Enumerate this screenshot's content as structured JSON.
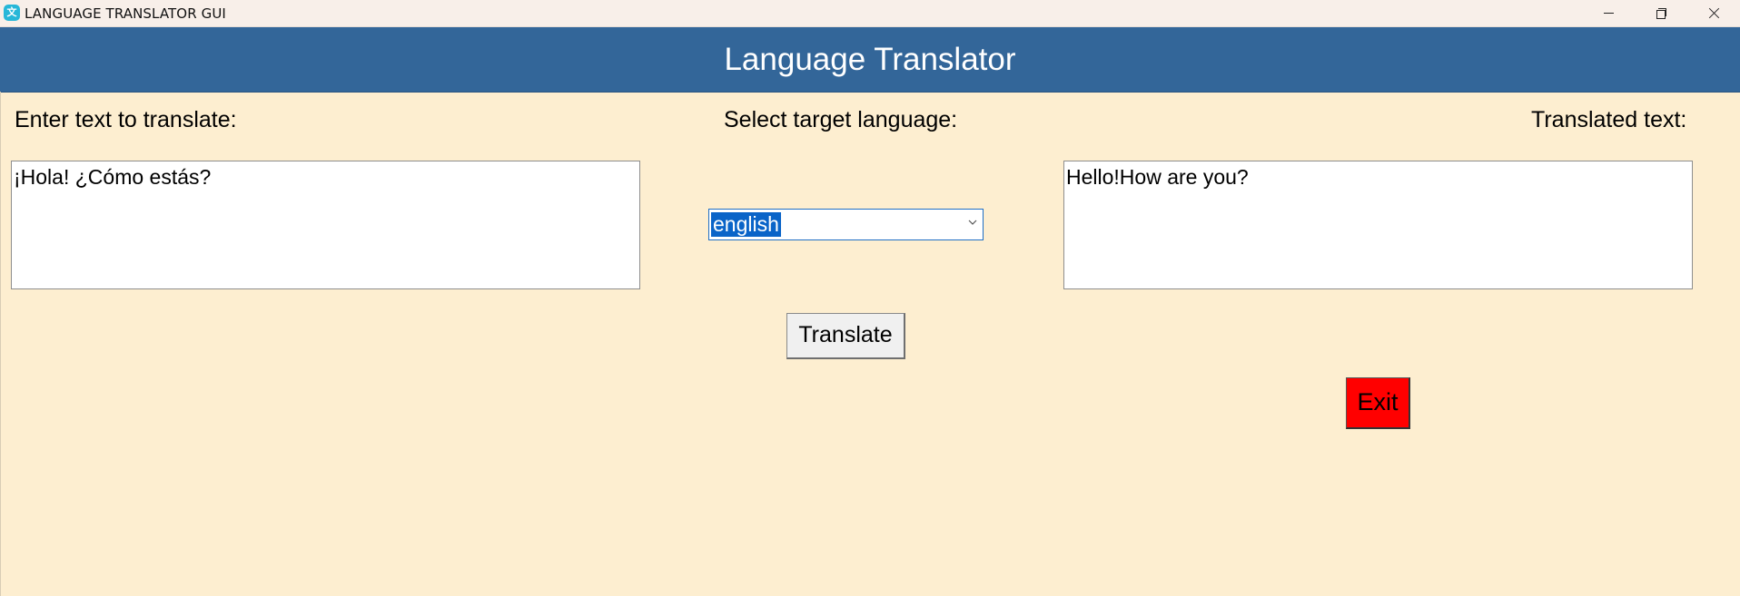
{
  "window": {
    "title": "LANGUAGE TRANSLATOR GUI",
    "app_icon": "translate-app-icon",
    "controls": [
      "minimize-icon",
      "maximize-icon",
      "close-icon"
    ]
  },
  "header": {
    "title": "Language Translator",
    "background_color": "#336699"
  },
  "source": {
    "label": "Enter text to translate:",
    "value": "¡Hola! ¿Cómo estás?"
  },
  "target": {
    "label": "Select target language:",
    "selected": "english"
  },
  "output": {
    "label": "Translated text:",
    "value": "Hello!How are you?"
  },
  "buttons": {
    "translate": "Translate",
    "exit": "Exit",
    "exit_color": "#ff0000"
  },
  "theme": {
    "background": "#fdeed0",
    "selection_highlight": "#0a64c8"
  }
}
